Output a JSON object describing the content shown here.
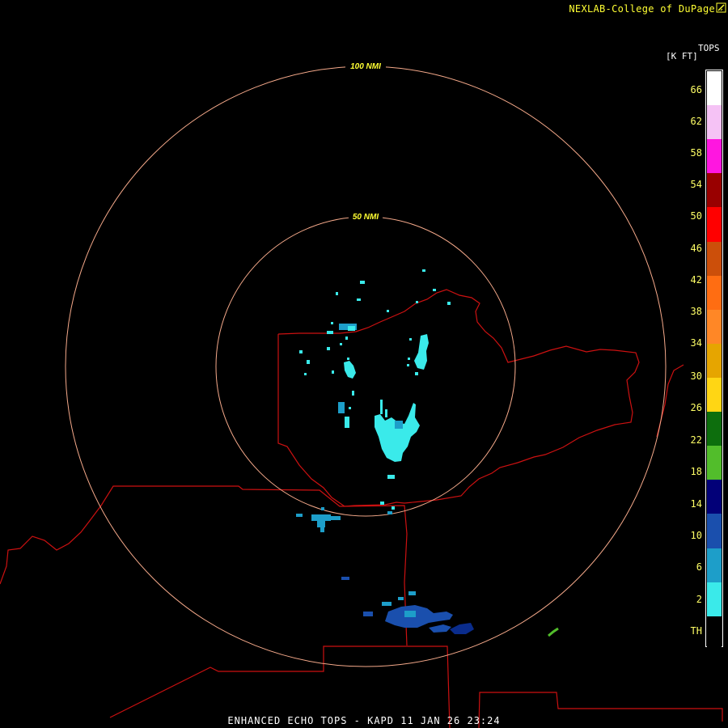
{
  "credit": {
    "text": "NEXLAB-College of DuPage",
    "icon": "cod-logo-icon"
  },
  "map": {
    "product": "Enhanced Echo Tops",
    "radar_site": "KAPD",
    "range_rings": [
      {
        "label": "100 NMI"
      },
      {
        "label": "50 NMI"
      }
    ],
    "colors": {
      "background": "#000000",
      "range_ring": "#f5a98a",
      "range_label": "#ffff33",
      "boundary": "#cc1111"
    }
  },
  "legend": {
    "title": "TOPS",
    "units": "[K FT]",
    "entries": [
      {
        "label": "66",
        "color": "#ffffff"
      },
      {
        "label": "62",
        "color": "#f5c2f5"
      },
      {
        "label": "58",
        "color": "#ff16e0"
      },
      {
        "label": "54",
        "color": "#990000"
      },
      {
        "label": "50",
        "color": "#ff0000"
      },
      {
        "label": "46",
        "color": "#cc4f0a"
      },
      {
        "label": "42",
        "color": "#ff6d12"
      },
      {
        "label": "38",
        "color": "#ff8726"
      },
      {
        "label": "34",
        "color": "#e6a500"
      },
      {
        "label": "30",
        "color": "#ffd614"
      },
      {
        "label": "26",
        "color": "#0d6e0d"
      },
      {
        "label": "22",
        "color": "#52bd2b"
      },
      {
        "label": "18",
        "color": "#020078"
      },
      {
        "label": "14",
        "color": "#1a4fad"
      },
      {
        "label": "10",
        "color": "#1d9ec9"
      },
      {
        "label": "6",
        "color": "#3aeaea"
      },
      {
        "label": "2",
        "color": "#000000"
      },
      {
        "label": "TH",
        "color": "#000000"
      }
    ]
  },
  "footer": {
    "text": "ENHANCED ECHO TOPS - KAPD 11 JAN 26 23:24"
  }
}
